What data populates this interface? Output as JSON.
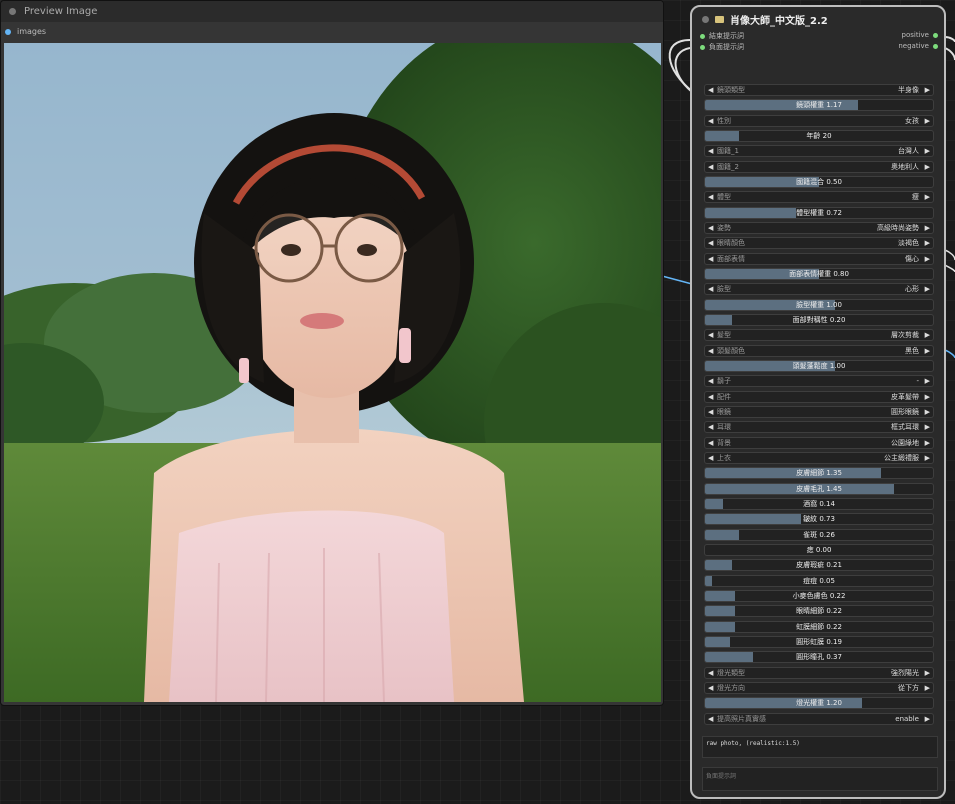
{
  "preview": {
    "title": "Preview Image",
    "input_label": "images"
  },
  "node": {
    "title": "肖像大師_中文版_2.2",
    "inputs": [
      "結束提示詞",
      "負面提示詞"
    ],
    "outputs": [
      "positive",
      "negative"
    ]
  },
  "widgets": [
    {
      "kind": "combo",
      "label": "鏡頭類型",
      "value": "半身像"
    },
    {
      "kind": "slider",
      "text": "鏡頭權重 1.17",
      "level": 0.67
    },
    {
      "kind": "combo",
      "label": "性別",
      "value": "女孩"
    },
    {
      "kind": "slider",
      "text": "年齡 20",
      "level": 0.15
    },
    {
      "kind": "combo",
      "label": "國籍_1",
      "value": "台灣人"
    },
    {
      "kind": "combo",
      "label": "國籍_2",
      "value": "奧地利人"
    },
    {
      "kind": "slider",
      "text": "國籍混合 0.50",
      "level": 0.5
    },
    {
      "kind": "combo",
      "label": "體型",
      "value": "瘦"
    },
    {
      "kind": "slider",
      "text": "體型權重 0.72",
      "level": 0.4
    },
    {
      "kind": "combo",
      "label": "姿勢",
      "value": "高級時尚姿勢"
    },
    {
      "kind": "combo",
      "label": "眼睛顏色",
      "value": "淡褐色"
    },
    {
      "kind": "combo",
      "label": "面部表情",
      "value": "傷心"
    },
    {
      "kind": "slider",
      "text": "面部表情權重 0.80",
      "level": 0.5
    },
    {
      "kind": "combo",
      "label": "臉型",
      "value": "心形"
    },
    {
      "kind": "slider",
      "text": "臉型權重 1.00",
      "level": 0.57
    },
    {
      "kind": "slider",
      "text": "面部對稱性 0.20",
      "level": 0.12
    },
    {
      "kind": "combo",
      "label": "髮型",
      "value": "層次剪裁"
    },
    {
      "kind": "combo",
      "label": "頭髮顏色",
      "value": "黑色"
    },
    {
      "kind": "slider",
      "text": "頭髮蓬鬆度 1.00",
      "level": 0.57
    },
    {
      "kind": "combo",
      "label": "鬍子",
      "value": "-"
    },
    {
      "kind": "combo",
      "label": "配件",
      "value": "皮革髮帶"
    },
    {
      "kind": "combo",
      "label": "眼鏡",
      "value": "圓形眼鏡"
    },
    {
      "kind": "combo",
      "label": "耳環",
      "value": "框式耳環"
    },
    {
      "kind": "combo",
      "label": "背景",
      "value": "公園綠地"
    },
    {
      "kind": "combo",
      "label": "上衣",
      "value": "公主緞禮服"
    },
    {
      "kind": "slider",
      "text": "皮膚細節 1.35",
      "level": 0.77
    },
    {
      "kind": "slider",
      "text": "皮膚毛孔 1.45",
      "level": 0.83
    },
    {
      "kind": "slider",
      "text": "酒窩 0.14",
      "level": 0.08
    },
    {
      "kind": "slider",
      "text": "皺紋 0.73",
      "level": 0.42
    },
    {
      "kind": "slider",
      "text": "雀斑 0.26",
      "level": 0.15
    },
    {
      "kind": "slider",
      "text": "痣 0.00",
      "level": 0.0
    },
    {
      "kind": "slider",
      "text": "皮膚瑕疵 0.21",
      "level": 0.12
    },
    {
      "kind": "slider",
      "text": "痘痘 0.05",
      "level": 0.03
    },
    {
      "kind": "slider",
      "text": "小麥色膚色 0.22",
      "level": 0.13
    },
    {
      "kind": "slider",
      "text": "眼睛細節 0.22",
      "level": 0.13
    },
    {
      "kind": "slider",
      "text": "虹膜細節 0.22",
      "level": 0.13
    },
    {
      "kind": "slider",
      "text": "圓形虹膜 0.19",
      "level": 0.11
    },
    {
      "kind": "slider",
      "text": "圓形瞳孔 0.37",
      "level": 0.21
    },
    {
      "kind": "combo",
      "label": "燈光類型",
      "value": "強烈陽光"
    },
    {
      "kind": "combo",
      "label": "燈光方向",
      "value": "從下方"
    },
    {
      "kind": "slider",
      "text": "燈光權重 1.20",
      "level": 0.69
    },
    {
      "kind": "combo",
      "label": "提高照片真實感",
      "value": "enable"
    }
  ],
  "positive_text": "raw photo, (realistic:1.5)",
  "negative_placeholder": "負面提示詞",
  "colors": {
    "accent_slider": "#5c6f80",
    "socket_green": "#7ddc7d",
    "socket_blue": "#64b5f6",
    "wire_white": "#e0e0e0"
  }
}
